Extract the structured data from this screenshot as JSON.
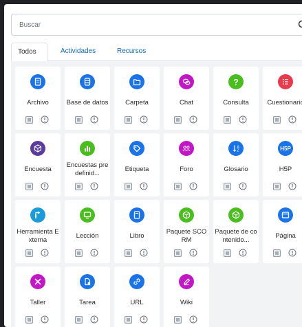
{
  "search": {
    "placeholder": "Buscar"
  },
  "tabs": [
    {
      "label": "Todos"
    },
    {
      "label": "Actividades"
    },
    {
      "label": "Recursos"
    }
  ],
  "modules": [
    {
      "name": "Archivo",
      "icon": "file-icon",
      "color": "#1a73e8"
    },
    {
      "name": "Base de datos",
      "icon": "database-icon",
      "color": "#1a73e8"
    },
    {
      "name": "Carpeta",
      "icon": "folder-icon",
      "color": "#1a73e8"
    },
    {
      "name": "Chat",
      "icon": "chat-icon",
      "color": "#c217c6"
    },
    {
      "name": "Consulta",
      "icon": "question-icon",
      "color": "#4bbe1f"
    },
    {
      "name": "Cuestionario",
      "icon": "checklist-icon",
      "color": "#e83a4a"
    },
    {
      "name": "Encuesta",
      "icon": "cube-icon",
      "color": "#5b3c9f"
    },
    {
      "name": "Encuestas predefinid...",
      "icon": "bar-chart-icon",
      "color": "#4bbe1f"
    },
    {
      "name": "Etiqueta",
      "icon": "tag-icon",
      "color": "#1a73e8"
    },
    {
      "name": "Foro",
      "icon": "people-icon",
      "color": "#c217c6"
    },
    {
      "name": "Glosario",
      "icon": "sort-az-icon",
      "color": "#1a73e8"
    },
    {
      "name": "H5P",
      "icon": "h5p-icon",
      "color": "#1a73e8"
    },
    {
      "name": "Herramienta Externa",
      "icon": "puzzle-icon",
      "color": "#1a9bdb"
    },
    {
      "name": "Lección",
      "icon": "monitor-icon",
      "color": "#4bbe1f"
    },
    {
      "name": "Libro",
      "icon": "book-icon",
      "color": "#1a73e8"
    },
    {
      "name": "Paquete SCORM",
      "icon": "package-icon",
      "color": "#4bbe1f"
    },
    {
      "name": "Paquete de contenido...",
      "icon": "package-icon",
      "color": "#4bbe1f"
    },
    {
      "name": "Página",
      "icon": "page-icon",
      "color": "#1a73e8"
    },
    {
      "name": "Taller",
      "icon": "tools-icon",
      "color": "#c217c6"
    },
    {
      "name": "Tarea",
      "icon": "assignment-icon",
      "color": "#1a73e8"
    },
    {
      "name": "URL",
      "icon": "link-icon",
      "color": "#1a73e8"
    },
    {
      "name": "Wiki",
      "icon": "pencil-icon",
      "color": "#c217c6"
    }
  ]
}
